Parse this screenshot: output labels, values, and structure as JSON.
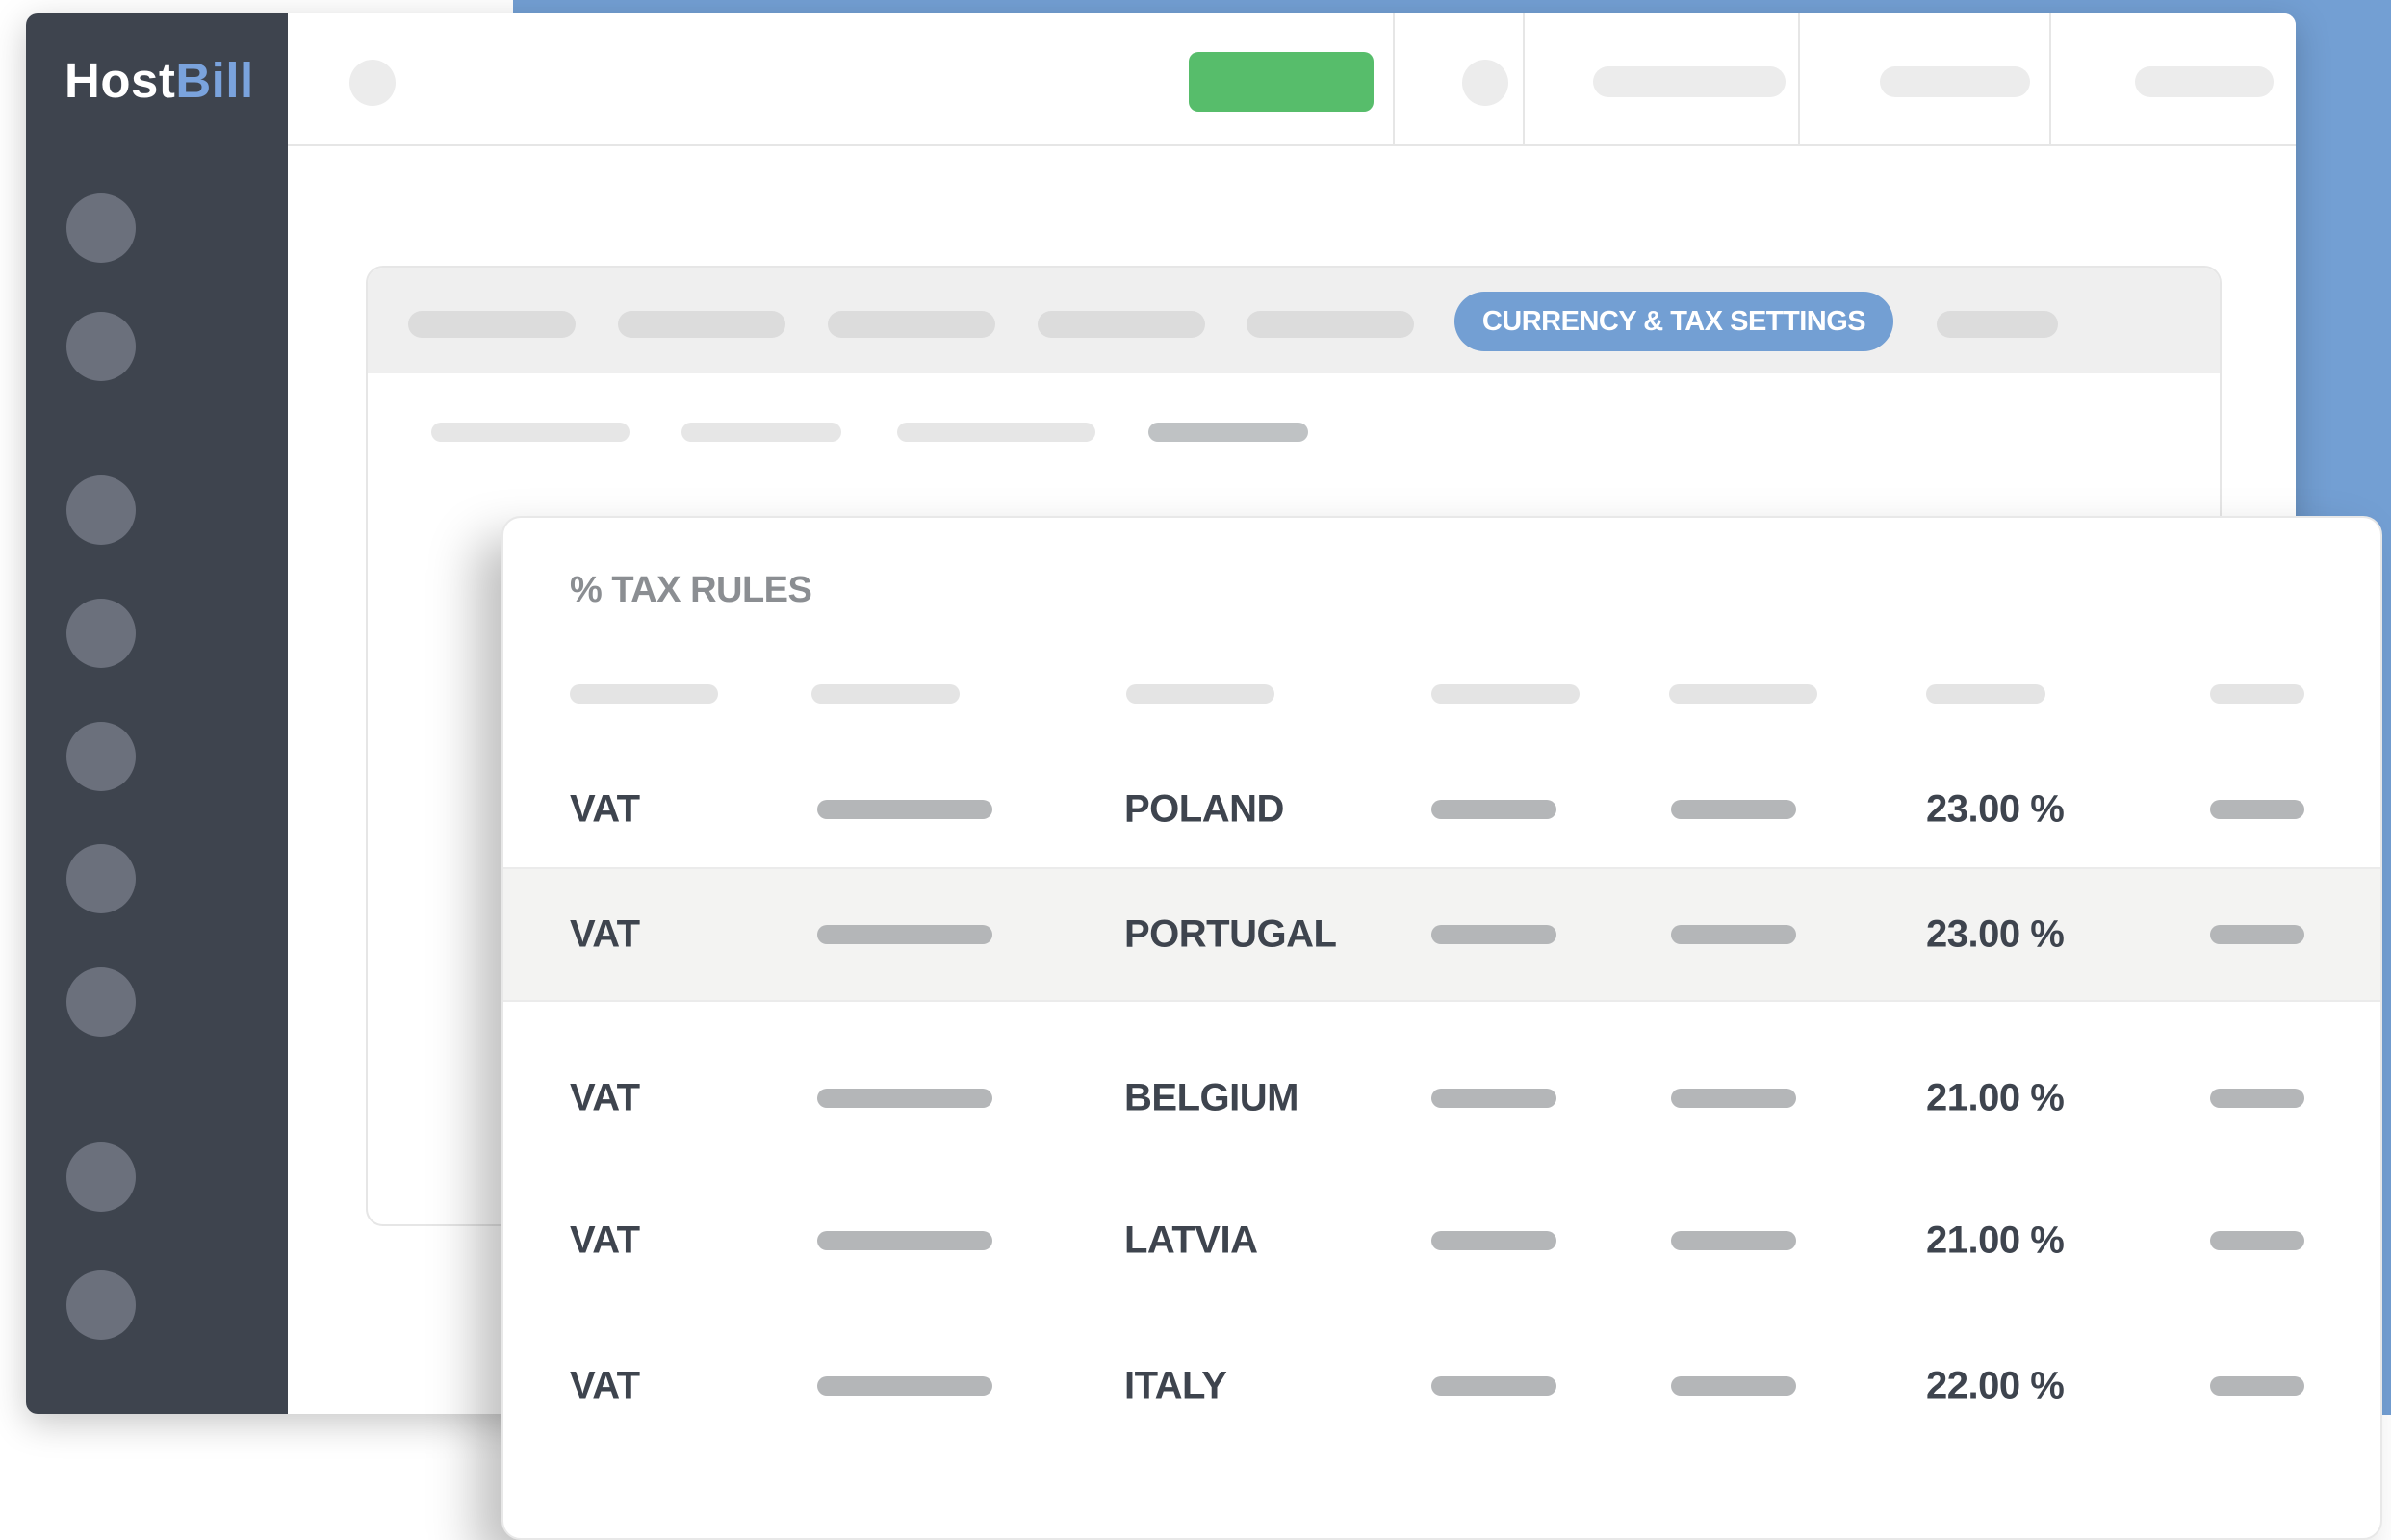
{
  "brand": {
    "host": "Host",
    "bill": "Bill"
  },
  "colors": {
    "accent": "#739fd3",
    "success": "#57bd6b",
    "sidebar": "#3e444e"
  },
  "tabs": {
    "active_label": "CURRENCY & TAX SETTINGS"
  },
  "tax_rules": {
    "title": "% TAX RULES",
    "rows": [
      {
        "type": "VAT",
        "country": "POLAND",
        "rate": "23.00 %"
      },
      {
        "type": "VAT",
        "country": "PORTUGAL",
        "rate": "23.00 %"
      },
      {
        "type": "VAT",
        "country": "BELGIUM",
        "rate": "21.00 %"
      },
      {
        "type": "VAT",
        "country": "LATVIA",
        "rate": "21.00 %"
      },
      {
        "type": "VAT",
        "country": "ITALY",
        "rate": "22.00 %"
      }
    ]
  }
}
